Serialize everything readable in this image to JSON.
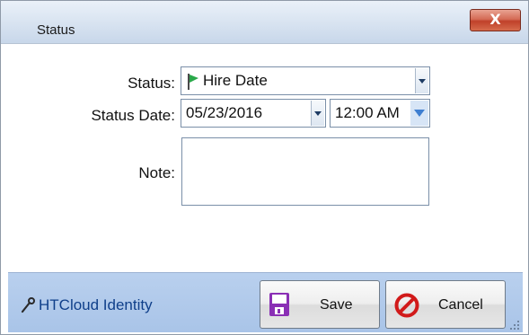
{
  "window": {
    "title": "Status",
    "close_symbol": "X"
  },
  "form": {
    "status_label": "Status:",
    "status_value": "Hire Date",
    "status_date_label": "Status Date:",
    "date_value": "05/23/2016",
    "time_value": "12:00 AM",
    "note_label": "Note:",
    "note_value": ""
  },
  "footer": {
    "identity_label": "HTCloud Identity",
    "save_label": "Save",
    "cancel_label": "Cancel"
  },
  "colors": {
    "flag": "#2aa84a",
    "save_icon": "#8a2fb5",
    "cancel_icon": "#d11a1a",
    "footer_bg": "#b3cbed"
  }
}
